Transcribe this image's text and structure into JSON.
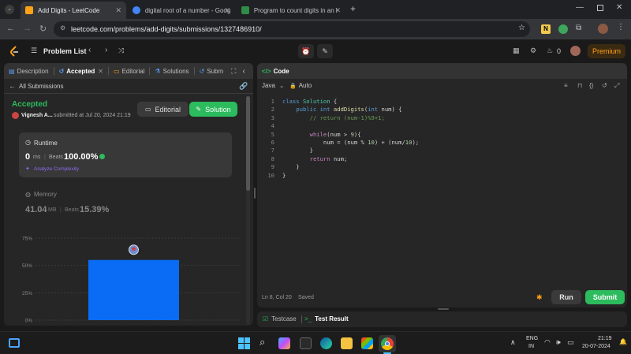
{
  "browser": {
    "tabs": [
      {
        "title": "Add Digits - LeetCode",
        "active": true,
        "favicon_color": "#ffa116"
      },
      {
        "title": "digital root of a number - Goog",
        "active": false,
        "favicon_color": "#4285f4"
      },
      {
        "title": "Program to count digits in an i",
        "active": false,
        "favicon_color": "#2f8d46"
      }
    ],
    "url": "leetcode.com/problems/add-digits/submissions/1327486910/"
  },
  "lc_nav": {
    "problem_list": "Problem List",
    "coins": "0",
    "premium": "Premium"
  },
  "left": {
    "tabs": {
      "description": "Description",
      "accepted": "Accepted",
      "editorial": "Editorial",
      "solutions": "Solutions",
      "submissions": "Subm"
    },
    "back_label": "All Submissions",
    "status": "Accepted",
    "user": "Vignesh A...",
    "submitted": "submitted at Jul 20, 2024 21:19",
    "editorial_btn": "Editorial",
    "solution_btn": "Solution",
    "runtime": {
      "title": "Runtime",
      "value": "0",
      "unit": "ms",
      "beats_label": "Beats",
      "beats_value": "100.00%",
      "analyze": "Analyze Complexity"
    },
    "memory": {
      "title": "Memory",
      "value": "41.04",
      "unit": "MB",
      "beats_label": "Beats",
      "beats_value": "15.39%"
    }
  },
  "chart_data": {
    "type": "bar",
    "y_ticks": [
      "75%",
      "50%",
      "25%",
      "0%"
    ],
    "ylim": [
      0,
      75
    ],
    "values": [
      55
    ],
    "bar_color": "#0a6cf5"
  },
  "code": {
    "header": "Code",
    "language": "Java",
    "mode": "Auto",
    "lines": [
      {
        "n": "1",
        "html": "<span class=\"kw\">class</span> <span class=\"ty\">Solution</span> {"
      },
      {
        "n": "2",
        "html": "    <span class=\"kw\">public</span> <span class=\"kw\">int</span> <span class=\"fn\">addDigits</span>(<span class=\"kw\">int</span> num) {"
      },
      {
        "n": "3",
        "html": "        <span class=\"cm\">// return (num-1)%9+1;</span>"
      },
      {
        "n": "4",
        "html": ""
      },
      {
        "n": "5",
        "html": "        <span class=\"ctl\">while</span>(num > <span class=\"num\">9</span>){"
      },
      {
        "n": "6",
        "html": "            num = (num % <span class=\"num\">10</span>) + (num/<span class=\"num\">10</span>);"
      },
      {
        "n": "7",
        "html": "        }"
      },
      {
        "n": "8",
        "html": "        <span class=\"ctl\">return</span> num;"
      },
      {
        "n": "9",
        "html": "    }"
      },
      {
        "n": "10",
        "html": "}"
      }
    ],
    "cursor": "Ln 8, Col 20",
    "saved": "Saved",
    "run": "Run",
    "submit": "Submit"
  },
  "bottom": {
    "testcase": "Testcase",
    "test_result": "Test Result"
  },
  "taskbar": {
    "lang_top": "ENG",
    "lang_bottom": "IN",
    "time": "21:19",
    "date": "20-07-2024"
  }
}
